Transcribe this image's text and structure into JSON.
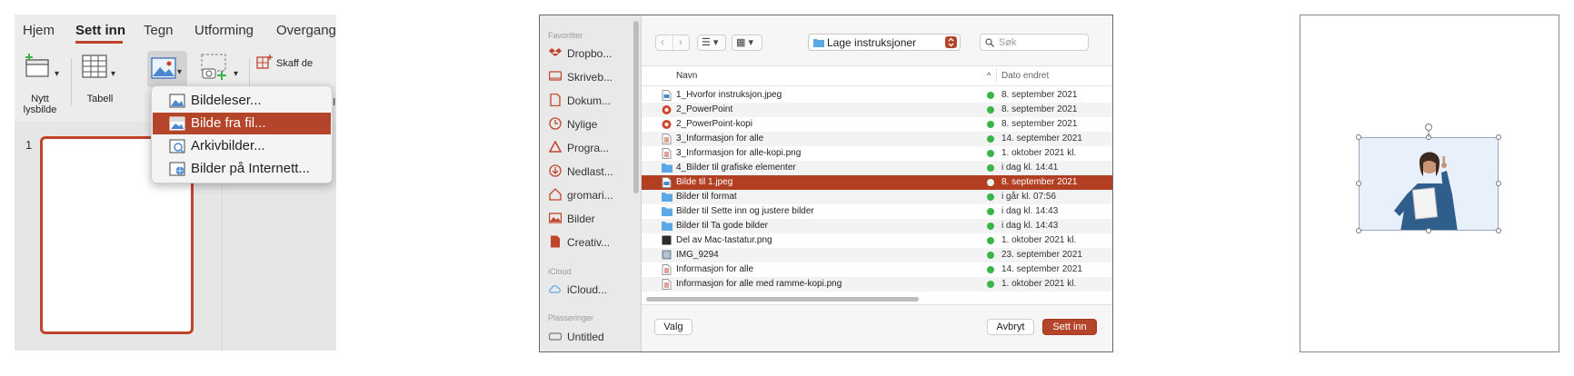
{
  "ribbon": {
    "tabs": [
      "Hjem",
      "Sett inn",
      "Tegn",
      "Utforming",
      "Overgange"
    ],
    "active_tab": "Sett inn",
    "new_slide_label_1": "Nytt",
    "new_slide_label_2": "lysbilde",
    "table_label": "Tabell",
    "get_addins_label": "Skaff de",
    "partial_label": "ll"
  },
  "picture_menu": {
    "items": [
      {
        "label": "Bildeleser...",
        "icon": "photo-browser-icon"
      },
      {
        "label": "Bilde fra fil...",
        "icon": "picture-from-file-icon"
      },
      {
        "label": "Arkivbilder...",
        "icon": "stock-images-icon"
      },
      {
        "label": "Bilder på Internett...",
        "icon": "online-pictures-icon"
      }
    ],
    "selected_index": 1
  },
  "thumbnails": {
    "slide_number": "1"
  },
  "dialog": {
    "sidebar": {
      "favorites_heading": "Favoritter",
      "favorites": [
        {
          "label": "Dropbo...",
          "icon": "dropbox-icon"
        },
        {
          "label": "Skriveb...",
          "icon": "desktop-icon"
        },
        {
          "label": "Dokum...",
          "icon": "documents-icon"
        },
        {
          "label": "Nylige",
          "icon": "recents-icon"
        },
        {
          "label": "Progra...",
          "icon": "applications-icon"
        },
        {
          "label": "Nedlast...",
          "icon": "downloads-icon"
        },
        {
          "label": "gromari...",
          "icon": "home-icon"
        },
        {
          "label": "Bilder",
          "icon": "pictures-icon"
        },
        {
          "label": "Creativ...",
          "icon": "creative-cloud-icon"
        }
      ],
      "icloud_heading": "iCloud",
      "icloud": [
        {
          "label": "iCloud...",
          "icon": "icloud-icon"
        }
      ],
      "locations_heading": "Plasseringer",
      "locations": [
        {
          "label": "Untitled",
          "icon": "drive-icon"
        }
      ]
    },
    "folder": "Lage instruksjoner",
    "search_placeholder": "Søk",
    "columns": {
      "name": "Navn",
      "date": "Dato endret"
    },
    "files": [
      {
        "name": "1_Hvorfor instruksjon.jpeg",
        "date": "8. september 2021",
        "type": "image"
      },
      {
        "name": "2_PowerPoint",
        "date": "8. september 2021",
        "type": "ppt"
      },
      {
        "name": "2_PowerPoint-kopi",
        "date": "8. september 2021",
        "type": "ppt"
      },
      {
        "name": "3_Informasjon for alle",
        "date": "14. september 2021",
        "type": "doc"
      },
      {
        "name": "3_Informasjon for alle-kopi.png",
        "date": "1. oktober 2021 kl.",
        "type": "doc"
      },
      {
        "name": "4_Bilder til grafiske elementer",
        "date": "i dag kl. 14:41",
        "type": "folder"
      },
      {
        "name": "Bilde til 1.jpeg",
        "date": "8. september 2021",
        "type": "image"
      },
      {
        "name": "Bilder til format",
        "date": "i går kl. 07:56",
        "type": "folder"
      },
      {
        "name": "Bilder til Sette inn og justere bilder",
        "date": "i dag kl. 14:43",
        "type": "folder"
      },
      {
        "name": "Bilder til Ta gode bilder",
        "date": "i dag kl. 14:43",
        "type": "folder"
      },
      {
        "name": "Del av Mac-tastatur.png",
        "date": "1. oktober 2021 kl.",
        "type": "dark"
      },
      {
        "name": "IMG_9294",
        "date": "23. september 2021",
        "type": "photo"
      },
      {
        "name": "Informasjon for alle",
        "date": "14. september 2021",
        "type": "doc"
      },
      {
        "name": "Informasjon for alle med ramme-kopi.png",
        "date": "1. oktober 2021 kl.",
        "type": "doc"
      }
    ],
    "selected_file_index": 6,
    "options_button": "Valg",
    "cancel_button": "Avbryt",
    "insert_button": "Sett inn"
  },
  "colors": {
    "accent": "#b5452a",
    "folder": "#5aa9e6",
    "check": "#3bb54a"
  }
}
